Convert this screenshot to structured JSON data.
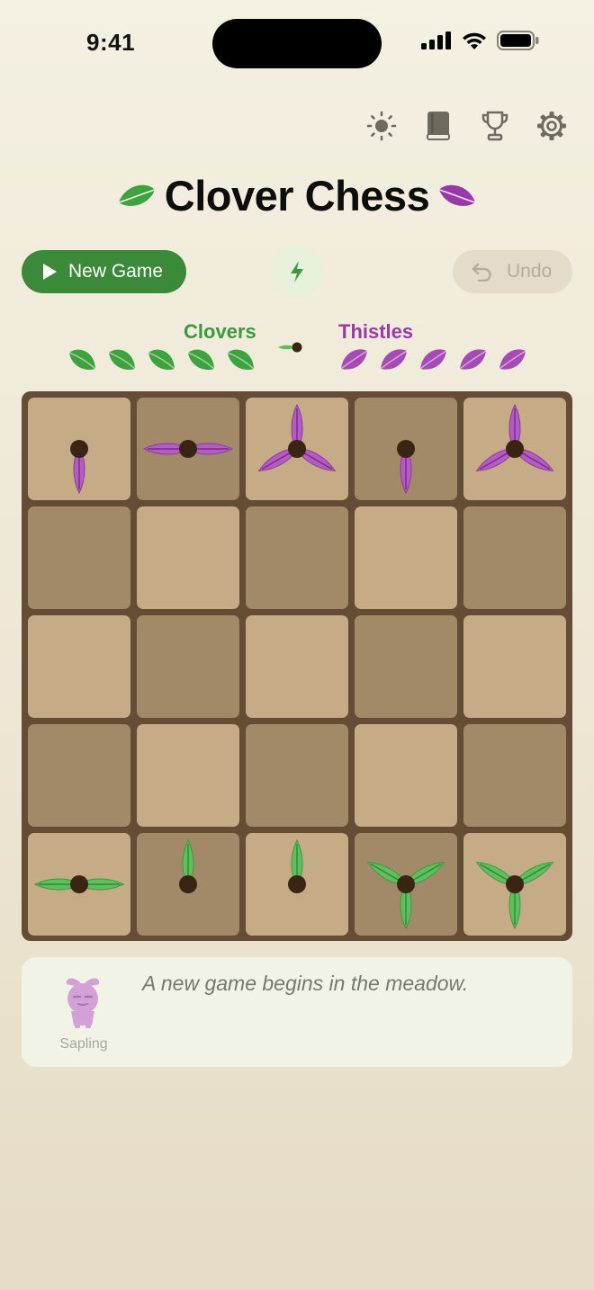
{
  "status_bar": {
    "time": "9:41"
  },
  "toolbar": {
    "icons": [
      "brightness-icon",
      "rules-book-icon",
      "trophy-icon",
      "settings-gear-icon"
    ]
  },
  "title": {
    "text": "Clover Chess",
    "left_icon": "green-leaf-icon",
    "right_icon": "purple-leaf-icon"
  },
  "actions": {
    "new_game_label": "New Game",
    "quick_icon": "lightning-bolt-icon",
    "undo_label": "Undo",
    "undo_enabled": false
  },
  "scoreboard": {
    "green_team": {
      "name": "Clovers",
      "pieces_remaining": 5,
      "color": "#3b9b3b"
    },
    "purple_team": {
      "name": "Thistles",
      "pieces_remaining": 5,
      "color": "#9a3aa6"
    },
    "turn": "Clovers"
  },
  "board": {
    "size": 5,
    "light_color": "#c5ab86",
    "dark_color": "#a28a68",
    "rows": [
      [
        {
          "color": "purple",
          "petals": [
            "down"
          ]
        },
        {
          "color": "purple",
          "petals": [
            "left",
            "right"
          ]
        },
        {
          "color": "purple",
          "petals": [
            "up",
            "down-left",
            "down-right"
          ]
        },
        {
          "color": "purple",
          "petals": [
            "down"
          ]
        },
        {
          "color": "purple",
          "petals": [
            "up",
            "down-left",
            "down-right"
          ]
        }
      ],
      [
        null,
        null,
        null,
        null,
        null
      ],
      [
        null,
        null,
        null,
        null,
        null
      ],
      [
        null,
        null,
        null,
        null,
        null
      ],
      [
        {
          "color": "green",
          "petals": [
            "left",
            "right"
          ]
        },
        {
          "color": "green",
          "petals": [
            "up"
          ]
        },
        {
          "color": "green",
          "petals": [
            "up"
          ]
        },
        {
          "color": "green",
          "petals": [
            "up-left",
            "up-right",
            "down"
          ]
        },
        {
          "color": "green",
          "petals": [
            "up-left",
            "up-right",
            "down"
          ]
        }
      ]
    ]
  },
  "message": {
    "speaker": "Sapling",
    "text": "A new game begins in the meadow.",
    "avatar_icon": "sapling-avatar-icon"
  }
}
